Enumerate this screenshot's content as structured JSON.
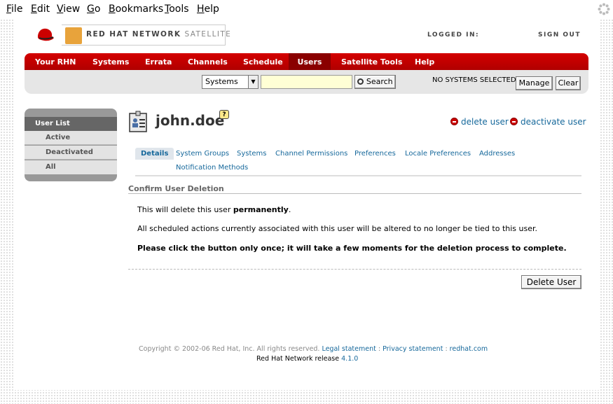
{
  "menubar": {
    "items": [
      "File",
      "Edit",
      "View",
      "Go",
      "Bookmarks",
      "Tools",
      "Help"
    ]
  },
  "header": {
    "brand_bold": "RED HAT NETWORK",
    "brand_light": "SATELLITE",
    "logged_in_label": "LOGGED IN:",
    "sign_out": "SIGN OUT",
    "colors": {
      "nav_red": "#cc0000",
      "link": "#16689b",
      "satellite_orange": "#e8a33b"
    }
  },
  "nav": {
    "items": [
      "Your RHN",
      "Systems",
      "Errata",
      "Channels",
      "Schedule",
      "Users",
      "Satellite Tools",
      "Help"
    ],
    "active": "Users"
  },
  "searchbar": {
    "select_value": "Systems",
    "search_button": "Search",
    "no_systems": "NO SYSTEMS SELECTED",
    "manage_button": "Manage",
    "clear_button": "Clear"
  },
  "sidebar": {
    "heading": "User List",
    "items": [
      "Active",
      "Deactivated",
      "All"
    ]
  },
  "page": {
    "title": "john.doe",
    "help_glyph": "?",
    "delete_user_link": "delete user",
    "deactivate_user_link": "deactivate user",
    "tabs": [
      "Details",
      "System Groups",
      "Systems",
      "Channel Permissions",
      "Preferences",
      "Locale Preferences",
      "Addresses",
      "Notification Methods"
    ],
    "selected_tab": "Details",
    "section_title": "Confirm User Deletion",
    "p1_pre": "This will delete this user ",
    "p1_bold": "permanently",
    "p1_post": ".",
    "p2": "All scheduled actions currently associated with this user will be altered to no longer be tied to this user.",
    "p3": "Please click the button only once; it will take a few moments for the deletion process to complete.",
    "delete_button": "Delete User"
  },
  "footer": {
    "copyright": "Copyright © 2002-06 Red Hat, Inc. All rights reserved.",
    "legal": "Legal statement",
    "sep1": " : ",
    "privacy": "Privacy statement",
    "sep2": " : ",
    "redhat": "redhat.com",
    "release_label": "Red Hat Network release ",
    "release_version": "4.1.0"
  }
}
